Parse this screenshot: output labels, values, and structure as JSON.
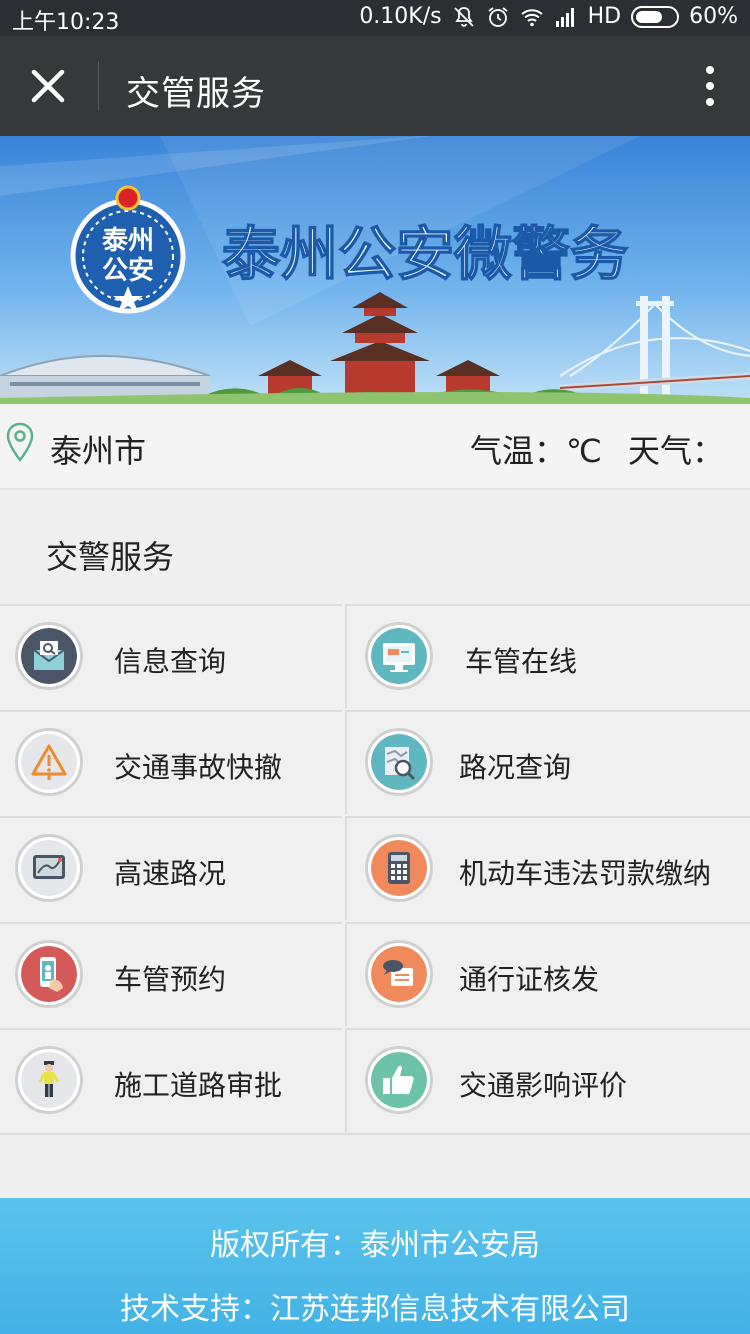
{
  "status_bar": {
    "time": "上午10:23",
    "network_speed": "0.10K/s",
    "network_type": "HD",
    "battery": "60%"
  },
  "title_bar": {
    "title": "交管服务",
    "close_icon": "close-icon",
    "more_icon": "more-vertical-icon"
  },
  "banner": {
    "headline": "泰州公安微警务",
    "emblem_text_top": "泰州",
    "emblem_text_bottom": "公安"
  },
  "location": {
    "city": "泰州市",
    "temperature_label": "气温：℃",
    "weather_label": "天气："
  },
  "section": {
    "title": "交警服务"
  },
  "services": [
    {
      "label": "信息查询",
      "icon": "mail-search-icon",
      "color": "#4a5568"
    },
    {
      "label": "车管在线",
      "icon": "monitor-icon",
      "color": "#5fb7c0"
    },
    {
      "label": "交通事故快撤",
      "icon": "warning-icon",
      "color": "#e5e7ea"
    },
    {
      "label": "路况查询",
      "icon": "map-search-icon",
      "color": "#5fb7c0"
    },
    {
      "label": "高速路况",
      "icon": "tablet-map-icon",
      "color": "#e5e7ea"
    },
    {
      "label": "机动车违法罚款缴纳",
      "icon": "calculator-icon",
      "color": "#f08a5d"
    },
    {
      "label": "车管预约",
      "icon": "phone-hand-icon",
      "color": "#d35a58"
    },
    {
      "label": "通行证核发",
      "icon": "pass-card-icon",
      "color": "#f08a5d"
    },
    {
      "label": "施工道路审批",
      "icon": "traffic-police-icon",
      "color": "#e5e7ea"
    },
    {
      "label": "交通影响评价",
      "icon": "thumbs-up-icon",
      "color": "#6cc3a8"
    }
  ],
  "footer": {
    "copyright": "版权所有：泰州市公安局",
    "support": "技术支持：江苏连邦信息技术有限公司"
  }
}
